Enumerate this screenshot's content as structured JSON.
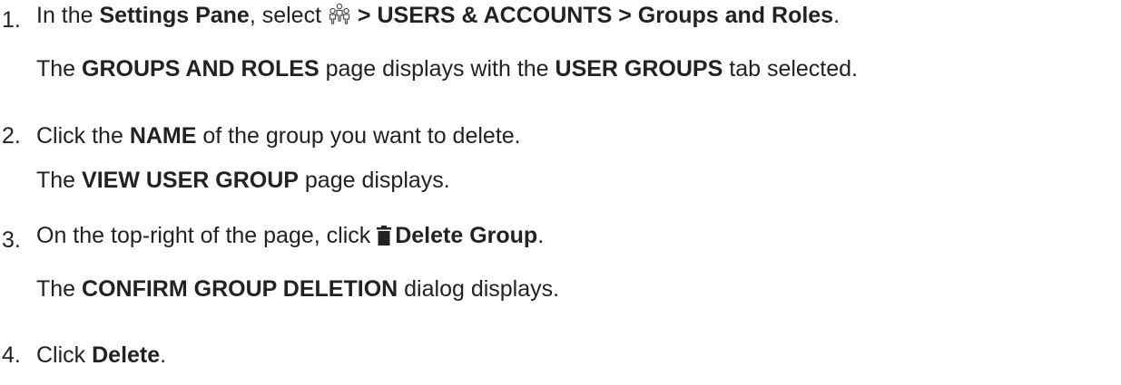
{
  "steps": [
    {
      "number": "1.",
      "instruction": {
        "prefix": "In the ",
        "location": "Settings Pane",
        "mid": ", select ",
        "icon": "users-group-icon",
        "path": " > USERS & ACCOUNTS > Groups and Roles",
        "suffix": "."
      },
      "result": {
        "prefix": "The ",
        "page": "GROUPS AND ROLES",
        "mid": " page displays with the ",
        "tab": "USER GROUPS",
        "suffix": " tab selected."
      }
    },
    {
      "number": "2.",
      "instruction": {
        "prefix": "Click the ",
        "field": "NAME",
        "suffix": " of the group you want to delete."
      },
      "result": {
        "prefix": "The ",
        "page": "VIEW USER GROUP",
        "suffix": " page displays."
      }
    },
    {
      "number": "3.",
      "instruction": {
        "prefix": "On the top-right of the page, click ",
        "icon": "trash-icon",
        "button": "Delete Group",
        "suffix": "."
      },
      "result": {
        "prefix": "The ",
        "dialog": "CONFIRM GROUP DELETION",
        "suffix": " dialog displays."
      }
    },
    {
      "number": "4.",
      "instruction": {
        "prefix": "Click ",
        "button": "Delete",
        "suffix": "."
      }
    }
  ]
}
